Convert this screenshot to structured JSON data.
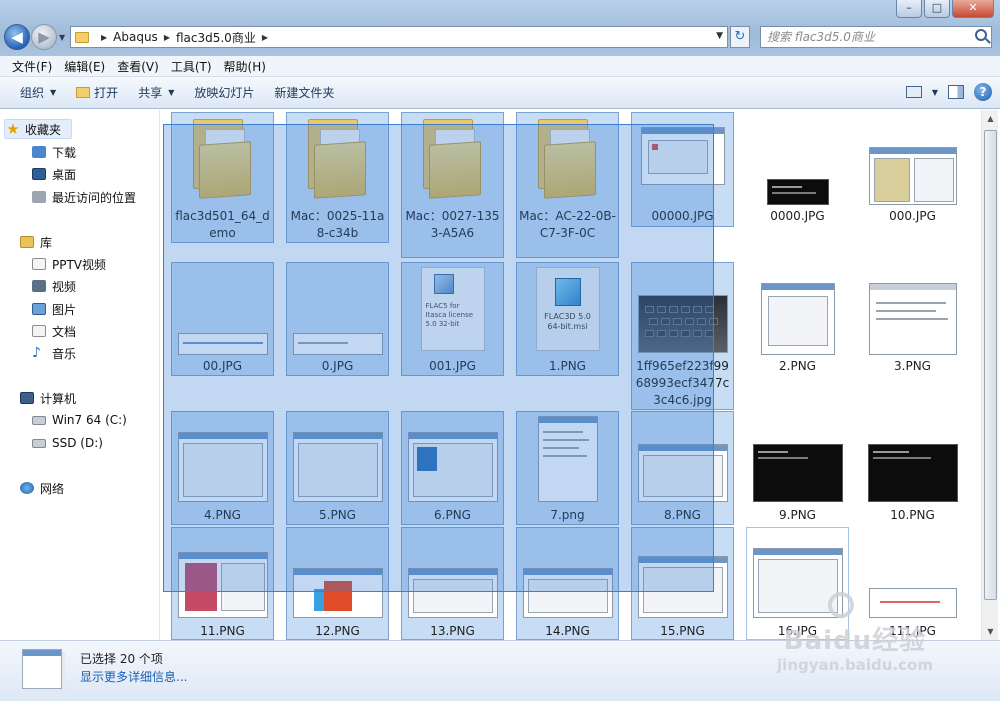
{
  "window": {
    "controls": {
      "minimize": "–",
      "maximize": "□",
      "close": "✕"
    }
  },
  "address": {
    "crumbs": [
      "Abaqus",
      "flac3d5.0商业"
    ],
    "search_placeholder": "搜索 flac3d5.0商业"
  },
  "menu": [
    "文件(F)",
    "编辑(E)",
    "查看(V)",
    "工具(T)",
    "帮助(H)"
  ],
  "toolbar": {
    "organize": "组织",
    "open": "打开",
    "share": "共享",
    "slideshow": "放映幻灯片",
    "new_folder": "新建文件夹"
  },
  "sidebar": {
    "favorites": "收藏夹",
    "fav_items": [
      "下载",
      "桌面",
      "最近访问的位置"
    ],
    "libraries": "库",
    "lib_items": [
      "PPTV视频",
      "视频",
      "图片",
      "文档",
      "音乐"
    ],
    "computer": "计算机",
    "drives": [
      "Win7 64 (C:)",
      "SSD (D:)"
    ],
    "network": "网络"
  },
  "files": [
    {
      "name": "flac3d501_64_demo",
      "type": "folder",
      "selected": true
    },
    {
      "name": "Mac：0025-11a8-c34b",
      "type": "folder",
      "selected": true
    },
    {
      "name": "Mac：0027-1353-A5A6",
      "type": "folder",
      "selected": true
    },
    {
      "name": "Mac：AC-22-0B-C7-3F-0C",
      "type": "folder",
      "selected": true
    },
    {
      "name": "00000.JPG",
      "type": "image",
      "selected": true
    },
    {
      "name": "0000.JPG",
      "type": "image",
      "selected": false
    },
    {
      "name": "000.JPG",
      "type": "image",
      "selected": false
    },
    {
      "name": "00.JPG",
      "type": "image",
      "selected": true
    },
    {
      "name": "0.JPG",
      "type": "image",
      "selected": true
    },
    {
      "name": "001.JPG",
      "type": "image",
      "selected": true
    },
    {
      "name": "1.PNG",
      "type": "image",
      "selected": true
    },
    {
      "name": "1ff965ef223f9968993ecf3477c3c4c6.jpg",
      "type": "image",
      "selected": true
    },
    {
      "name": "2.PNG",
      "type": "image",
      "selected": false
    },
    {
      "name": "3.PNG",
      "type": "image",
      "selected": false
    },
    {
      "name": "4.PNG",
      "type": "image",
      "selected": true
    },
    {
      "name": "5.PNG",
      "type": "image",
      "selected": true
    },
    {
      "name": "6.PNG",
      "type": "image",
      "selected": true
    },
    {
      "name": "7.png",
      "type": "image",
      "selected": true
    },
    {
      "name": "8.PNG",
      "type": "image",
      "selected": true
    },
    {
      "name": "9.PNG",
      "type": "image",
      "selected": false
    },
    {
      "name": "10.PNG",
      "type": "image",
      "selected": false
    },
    {
      "name": "11.PNG",
      "type": "image",
      "selected": true
    },
    {
      "name": "12.PNG",
      "type": "image",
      "selected": true
    },
    {
      "name": "13.PNG",
      "type": "image",
      "selected": true
    },
    {
      "name": "14.PNG",
      "type": "image",
      "selected": true
    },
    {
      "name": "15.PNG",
      "type": "image",
      "selected": true
    },
    {
      "name": "16.JPG",
      "type": "image",
      "selected": false
    },
    {
      "name": "111.JPG",
      "type": "image",
      "selected": false
    }
  ],
  "thumb_text": {
    "msi": "FLAC3D 5.0 64-bit.msi",
    "doc": "FLAC5 for Itasca license 5.0 32-bit"
  },
  "details": {
    "selected_count": "已选择 20 个项",
    "show_more": "显示更多详细信息..."
  },
  "watermark": {
    "brand": "Baidu经验",
    "url": "jingyan.baidu.com"
  },
  "colors": {
    "selection": "#3c7fd1",
    "link": "#1b5fb4",
    "accent": "#2563b8"
  }
}
